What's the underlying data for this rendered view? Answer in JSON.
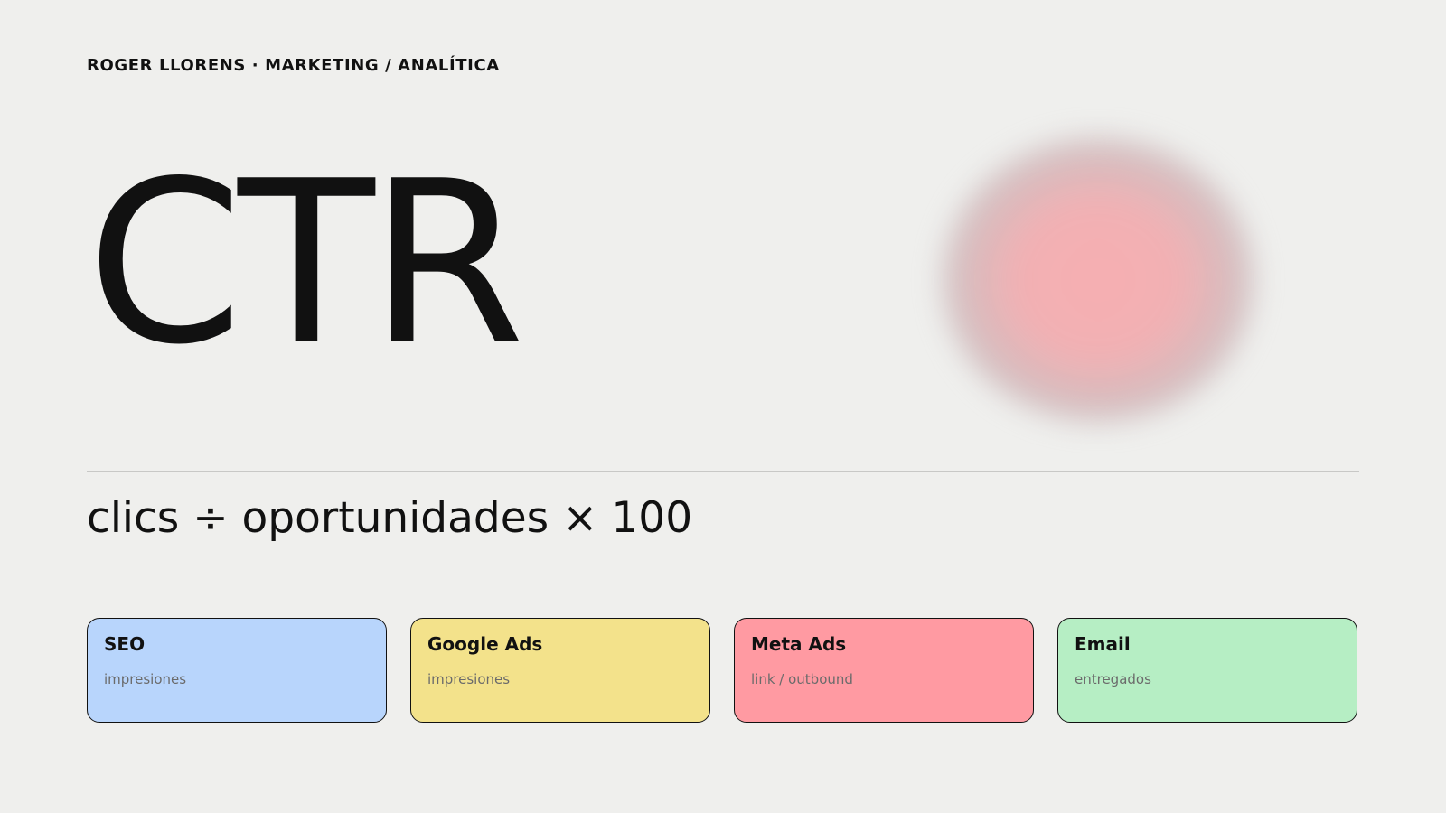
{
  "header": {
    "eyebrow": "ROGER LLORENS · MARKETING / ANALÍTICA"
  },
  "hero": {
    "title": "CTR",
    "formula": "clics ÷ oportunidades × 100"
  },
  "cards": [
    {
      "title": "SEO",
      "subtitle": "impresiones",
      "color": "#b8d5fc"
    },
    {
      "title": "Google Ads",
      "subtitle": "impresiones",
      "color": "#f3e28b"
    },
    {
      "title": "Meta Ads",
      "subtitle": "link / outbound",
      "color": "#ff9aa2"
    },
    {
      "title": "Email",
      "subtitle": "entregados",
      "color": "#b6eec4"
    }
  ],
  "colors": {
    "background": "#efefed",
    "text": "#111111",
    "blob": "#f4b0b3"
  }
}
